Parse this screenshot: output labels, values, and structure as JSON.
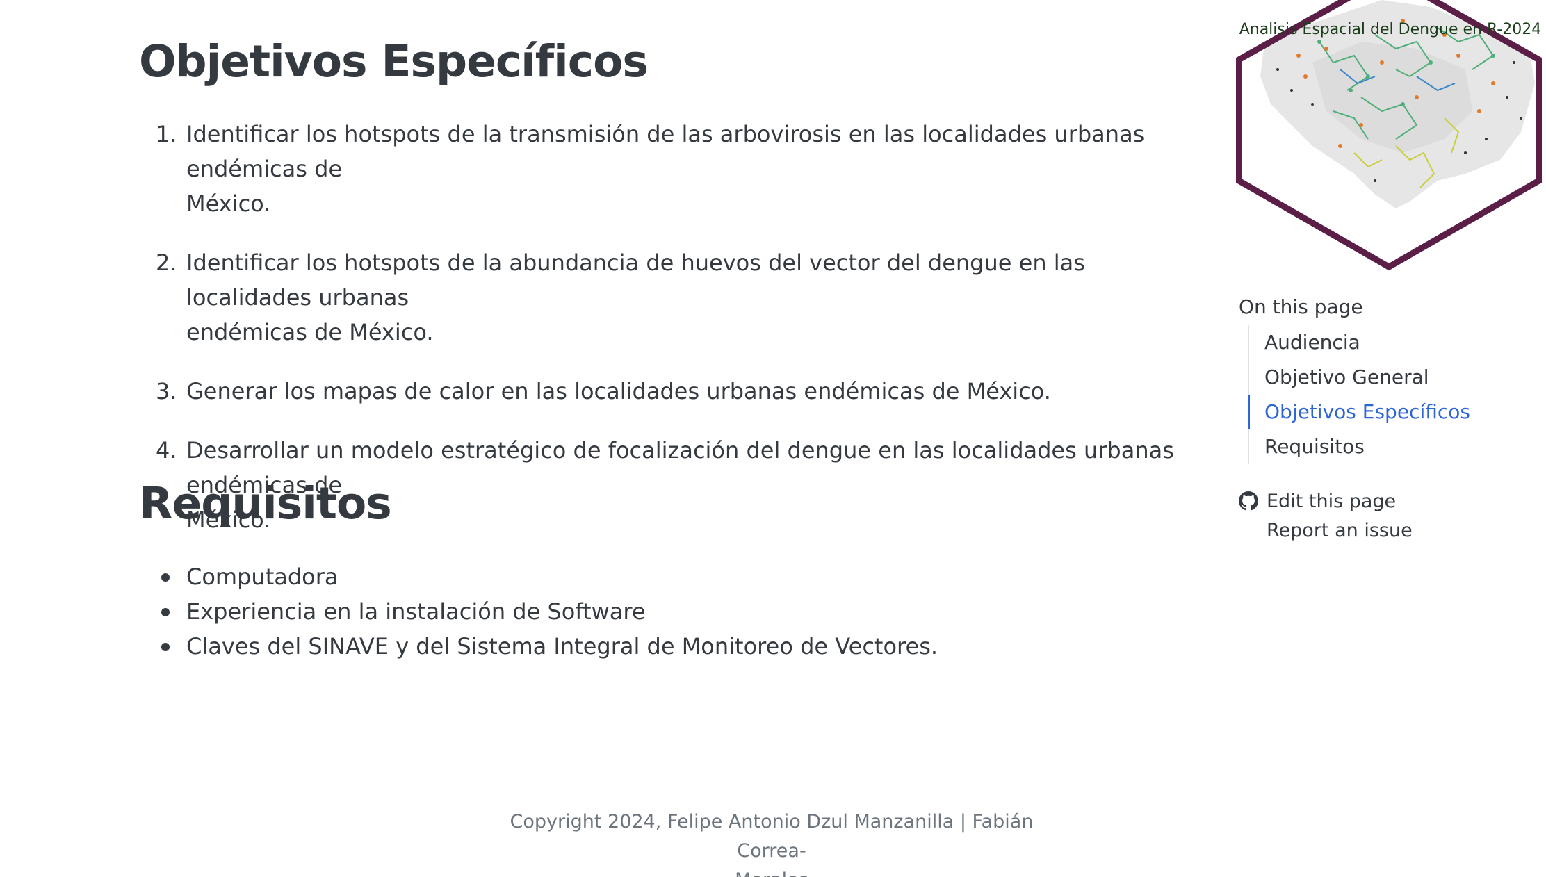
{
  "logo": {
    "title": "Analisis Espacial del Dengue en R-2024",
    "border_color": "#5b1e47"
  },
  "objetivos": {
    "title": "Objetivos Específicos",
    "items": [
      {
        "num": "1.",
        "line1": "Identificar los hotspots de la transmisión de las arbovirosis en las localidades urbanas endémicas de",
        "line2": "México."
      },
      {
        "num": "2.",
        "line1": "Identificar los hotspots de la abundancia de huevos del vector del dengue en las localidades urbanas",
        "line2": "endémicas de México."
      },
      {
        "num": "3.",
        "line1": "Generar los mapas de calor en las localidades urbanas endémicas de México.",
        "line2": ""
      },
      {
        "num": "4.",
        "line1": "Desarrollar un modelo estratégico de focalización del dengue en las localidades urbanas endémicas de",
        "line2": "México."
      }
    ]
  },
  "requisitos": {
    "title": "Requisitos",
    "items": [
      "Computadora",
      "Experiencia en la instalación de Software",
      "Claves del SINAVE y del Sistema Integral de Monitoreo de Vectores."
    ]
  },
  "toc": {
    "heading": "On this page",
    "items": [
      "Audiencia",
      "Objetivo General",
      "Objetivos Específicos",
      "Requisitos"
    ],
    "active_color": "#2f66d6"
  },
  "links": {
    "edit": "Edit this page",
    "issue": "Report an issue",
    "edit_icon": "github-icon"
  },
  "footer": {
    "line1": "Copyright 2024, Felipe Antonio Dzul Manzanilla | Fabián Correa-",
    "line2": "Morales"
  }
}
